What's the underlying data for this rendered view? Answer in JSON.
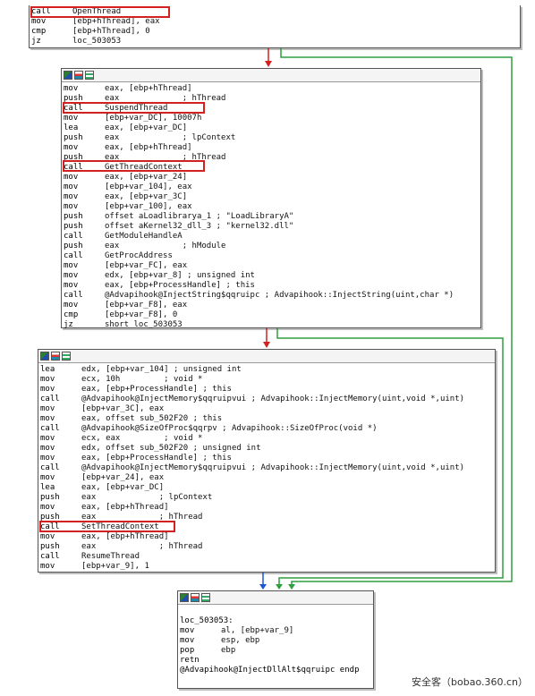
{
  "colors": {
    "highlight": "#d32020",
    "edge_true": "#2e9e3e",
    "edge_false": "#d32020",
    "edge_uncond": "#1e55d0"
  },
  "icons": [
    "graph-view-icon",
    "chart-icon",
    "text-view-icon"
  ],
  "blocks": [
    {
      "id": "block-top",
      "lines": [
        {
          "mn": "call",
          "op": "OpenThread"
        },
        {
          "mn": "mov",
          "op": "[ebp+hThread], eax"
        },
        {
          "mn": "cmp",
          "op": "[ebp+hThread], 0"
        },
        {
          "mn": "jz",
          "op": "loc_503053"
        }
      ]
    },
    {
      "id": "block-suspend",
      "lines": [
        {
          "mn": "mov",
          "op": "eax, [ebp+hThread]"
        },
        {
          "mn": "push",
          "op": "eax             ; hThread"
        },
        {
          "mn": "call",
          "op": "SuspendThread"
        },
        {
          "mn": "mov",
          "op": "[ebp+var_DC], 10007h"
        },
        {
          "mn": "lea",
          "op": "eax, [ebp+var_DC]"
        },
        {
          "mn": "push",
          "op": "eax             ; lpContext"
        },
        {
          "mn": "mov",
          "op": "eax, [ebp+hThread]"
        },
        {
          "mn": "push",
          "op": "eax             ; hThread"
        },
        {
          "mn": "call",
          "op": "GetThreadContext"
        },
        {
          "mn": "mov",
          "op": "eax, [ebp+var_24]"
        },
        {
          "mn": "mov",
          "op": "[ebp+var_104], eax"
        },
        {
          "mn": "mov",
          "op": "eax, [ebp+var_3C]"
        },
        {
          "mn": "mov",
          "op": "[ebp+var_100], eax"
        },
        {
          "mn": "push",
          "op": "offset aLoadlibrarya_1 ; \"LoadLibraryA\""
        },
        {
          "mn": "push",
          "op": "offset aKernel32_dll_3 ; \"kernel32.dll\""
        },
        {
          "mn": "call",
          "op": "GetModuleHandleA"
        },
        {
          "mn": "push",
          "op": "eax             ; hModule"
        },
        {
          "mn": "call",
          "op": "GetProcAddress"
        },
        {
          "mn": "mov",
          "op": "[ebp+var_FC], eax"
        },
        {
          "mn": "mov",
          "op": "edx, [ebp+var_8] ; unsigned int"
        },
        {
          "mn": "mov",
          "op": "eax, [ebp+ProcessHandle] ; this"
        },
        {
          "mn": "call",
          "op": "@Advapihook@InjectString$qqruipc ; Advapihook::InjectString(uint,char *)"
        },
        {
          "mn": "mov",
          "op": "[ebp+var_F8], eax"
        },
        {
          "mn": "cmp",
          "op": "[ebp+var_F8], 0"
        },
        {
          "mn": "jz",
          "op": "short loc_503053"
        }
      ]
    },
    {
      "id": "block-inject",
      "lines": [
        {
          "mn": "lea",
          "op": "edx, [ebp+var_104] ; unsigned int"
        },
        {
          "mn": "mov",
          "op": "ecx, 10h         ; void *"
        },
        {
          "mn": "mov",
          "op": "eax, [ebp+ProcessHandle] ; this"
        },
        {
          "mn": "call",
          "op": "@Advapihook@InjectMemory$qqruipvui ; Advapihook::InjectMemory(uint,void *,uint)"
        },
        {
          "mn": "mov",
          "op": "[ebp+var_3C], eax"
        },
        {
          "mn": "mov",
          "op": "eax, offset sub_502F20 ; this"
        },
        {
          "mn": "call",
          "op": "@Advapihook@SizeOfProc$qqrpv ; Advapihook::SizeOfProc(void *)"
        },
        {
          "mn": "mov",
          "op": "ecx, eax         ; void *"
        },
        {
          "mn": "mov",
          "op": "edx, offset sub_502F20 ; unsigned int"
        },
        {
          "mn": "mov",
          "op": "eax, [ebp+ProcessHandle] ; this"
        },
        {
          "mn": "call",
          "op": "@Advapihook@InjectMemory$qqruipvui ; Advapihook::InjectMemory(uint,void *,uint)"
        },
        {
          "mn": "mov",
          "op": "[ebp+var_24], eax"
        },
        {
          "mn": "lea",
          "op": "eax, [ebp+var_DC]"
        },
        {
          "mn": "push",
          "op": "eax             ; lpContext"
        },
        {
          "mn": "mov",
          "op": "eax, [ebp+hThread]"
        },
        {
          "mn": "push",
          "op": "eax             ; hThread"
        },
        {
          "mn": "call",
          "op": "SetThreadContext"
        },
        {
          "mn": "mov",
          "op": "eax, [ebp+hThread]"
        },
        {
          "mn": "push",
          "op": "eax             ; hThread"
        },
        {
          "mn": "call",
          "op": "ResumeThread"
        },
        {
          "mn": "mov",
          "op": "[ebp+var_9], 1"
        }
      ]
    },
    {
      "id": "block-exit",
      "lines": [
        {
          "mn": "",
          "op": ""
        },
        {
          "mn": "loc_503053:",
          "op": ""
        },
        {
          "mn": "mov",
          "op": "al, [ebp+var_9]"
        },
        {
          "mn": "mov",
          "op": "esp, ebp"
        },
        {
          "mn": "pop",
          "op": "ebp"
        },
        {
          "mn": "retn",
          "op": ""
        },
        {
          "mn": "@Advapihook@InjectDllAlt$qqruipc endp",
          "op": ""
        }
      ]
    }
  ],
  "watermark": "安全客（bobao.360.cn）"
}
